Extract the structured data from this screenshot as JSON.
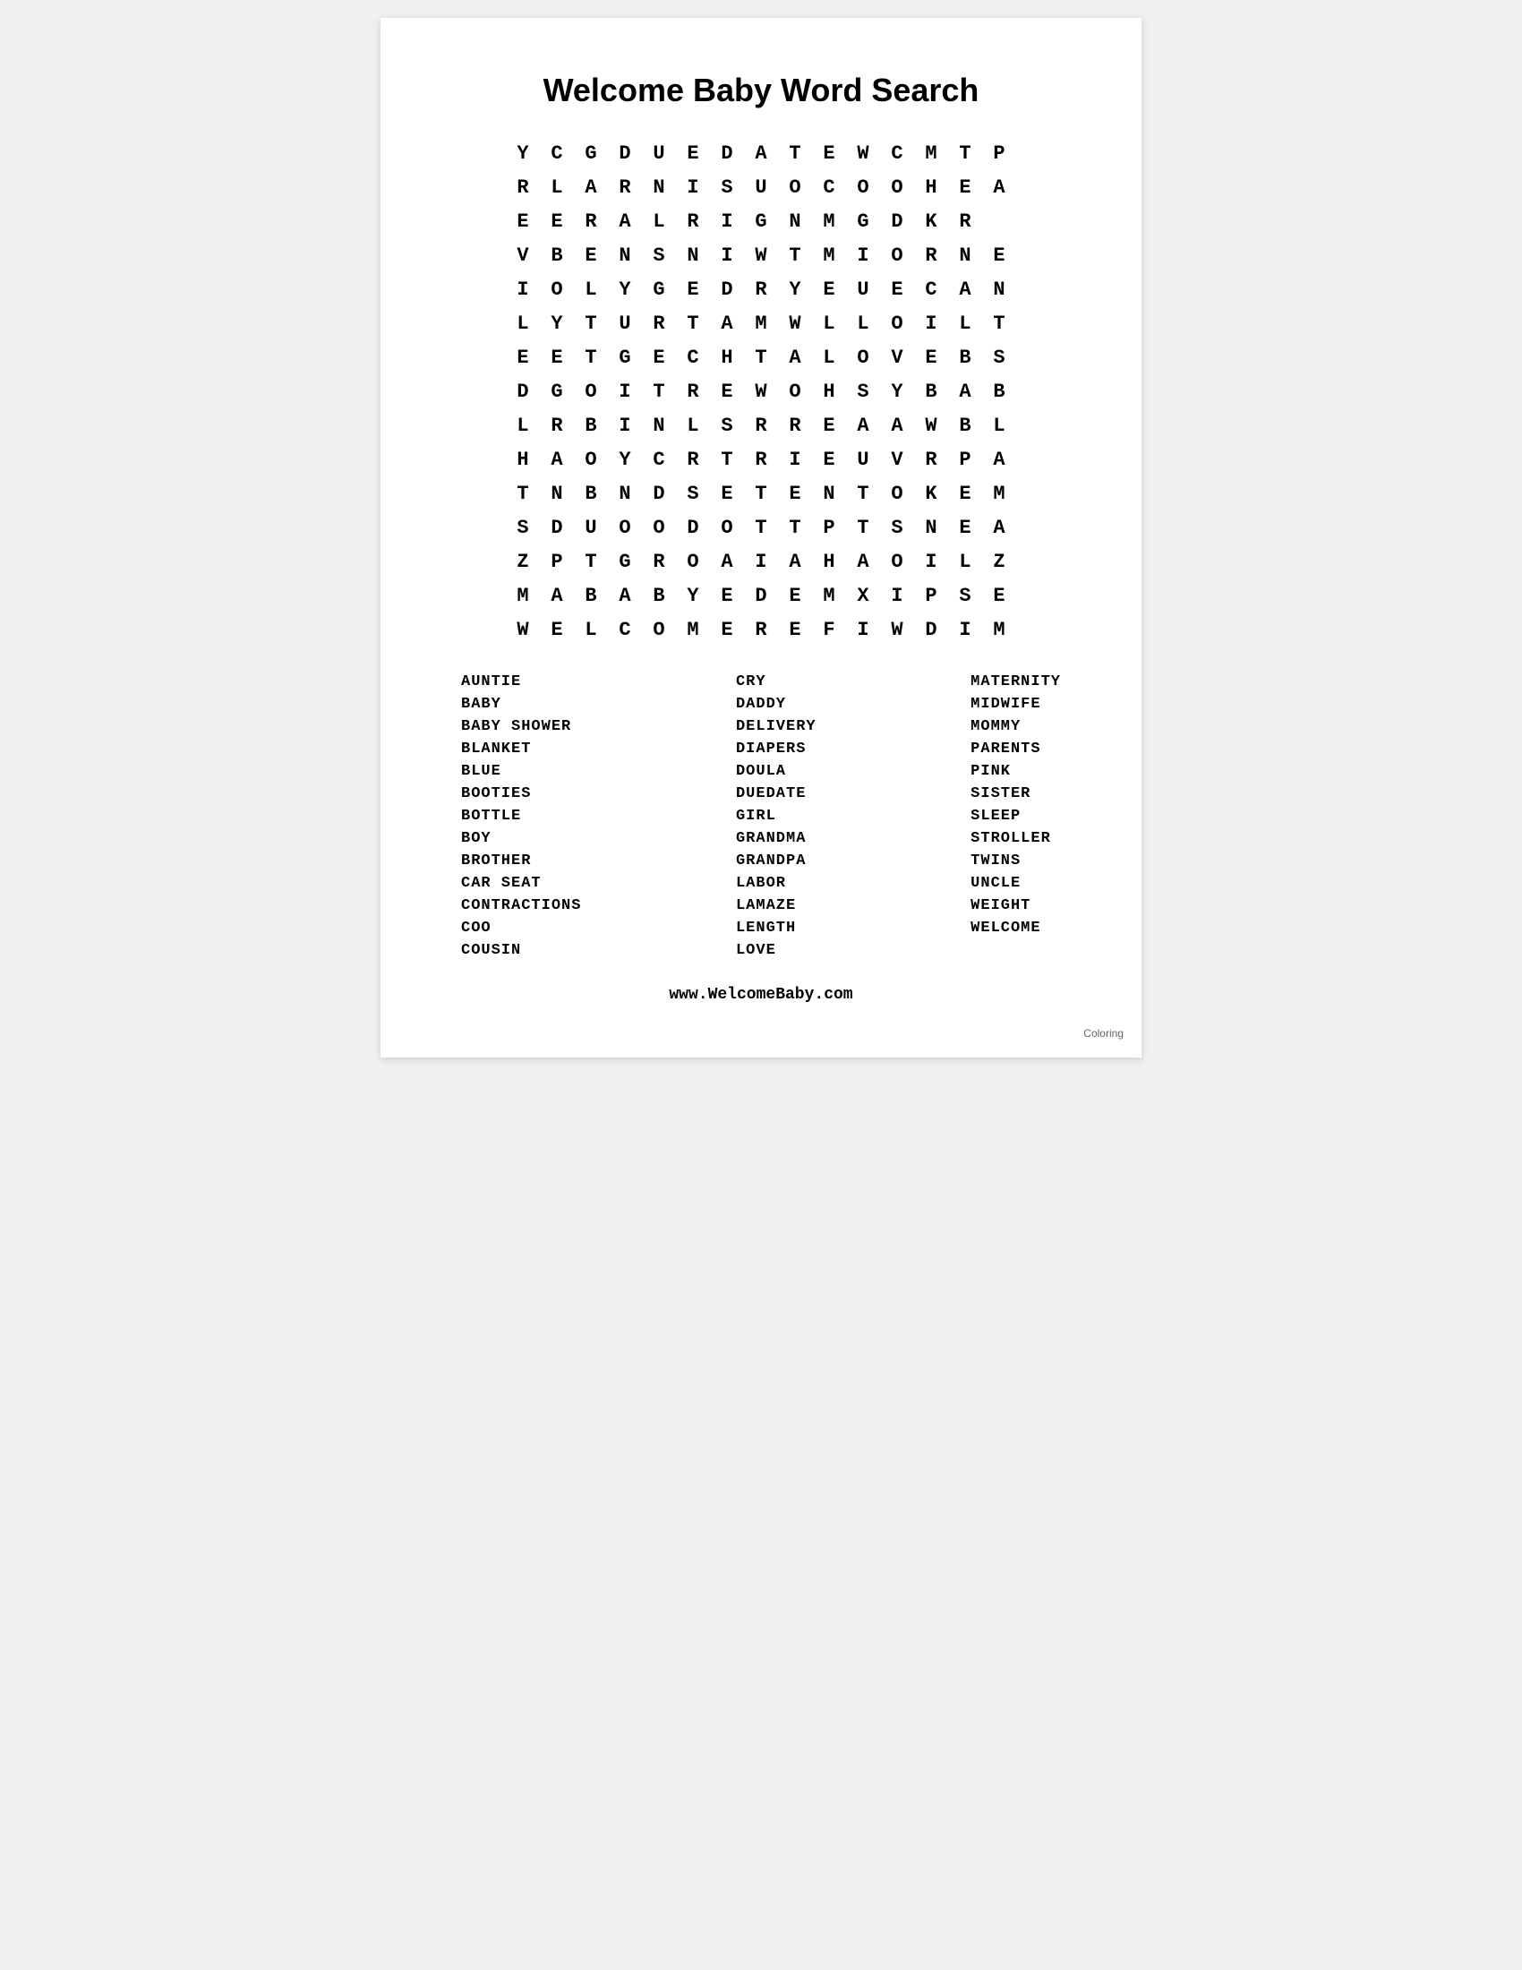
{
  "page": {
    "title": "Welcome Baby Word Search",
    "grid": [
      [
        "Y",
        "C",
        "G",
        "D",
        "U",
        "E",
        "D",
        "A",
        "T",
        "E",
        "W",
        "C",
        "M",
        "T",
        "P"
      ],
      [
        "R",
        "L",
        "A",
        "R",
        "N",
        "I",
        "S",
        "U",
        "O",
        "C",
        "O",
        "O",
        "H",
        "E",
        "A"
      ],
      [
        "E",
        "E",
        "R",
        "A",
        "L",
        "R",
        "I",
        "G",
        "N",
        "M",
        "G",
        "D",
        "K",
        "R",
        ""
      ],
      [
        "V",
        "B",
        "E",
        "N",
        "S",
        "N",
        "I",
        "W",
        "T",
        "M",
        "I",
        "O",
        "R",
        "N",
        "E"
      ],
      [
        "I",
        "O",
        "L",
        "Y",
        "G",
        "E",
        "D",
        "R",
        "Y",
        "E",
        "U",
        "E",
        "C",
        "A",
        "N"
      ],
      [
        "L",
        "Y",
        "T",
        "U",
        "R",
        "T",
        "A",
        "M",
        "W",
        "L",
        "L",
        "O",
        "I",
        "L",
        "T"
      ],
      [
        "E",
        "E",
        "T",
        "G",
        "E",
        "C",
        "H",
        "T",
        "A",
        "L",
        "O",
        "V",
        "E",
        "B",
        "S"
      ],
      [
        "D",
        "G",
        "O",
        "I",
        "T",
        "R",
        "E",
        "W",
        "O",
        "H",
        "S",
        "Y",
        "B",
        "A",
        "B"
      ],
      [
        "L",
        "R",
        "B",
        "I",
        "N",
        "L",
        "S",
        "R",
        "R",
        "E",
        "A",
        "A",
        "W",
        "B",
        "L"
      ],
      [
        "H",
        "A",
        "O",
        "Y",
        "C",
        "R",
        "T",
        "R",
        "I",
        "E",
        "U",
        "V",
        "R",
        "P",
        "A"
      ],
      [
        "T",
        "N",
        "B",
        "N",
        "D",
        "S",
        "E",
        "T",
        "E",
        "N",
        "T",
        "O",
        "K",
        "E",
        "M"
      ],
      [
        "S",
        "D",
        "U",
        "O",
        "O",
        "D",
        "O",
        "T",
        "T",
        "P",
        "T",
        "S",
        "N",
        "E",
        "A"
      ],
      [
        "Z",
        "P",
        "T",
        "G",
        "R",
        "O",
        "A",
        "I",
        "A",
        "H",
        "A",
        "O",
        "I",
        "L",
        "Z"
      ],
      [
        "M",
        "A",
        "B",
        "A",
        "B",
        "Y",
        "E",
        "D",
        "E",
        "M",
        "X",
        "I",
        "P",
        "S",
        "E"
      ],
      [
        "W",
        "E",
        "L",
        "C",
        "O",
        "M",
        "E",
        "R",
        "E",
        "F",
        "I",
        "W",
        "D",
        "I",
        "M"
      ]
    ],
    "word_list": {
      "column1": [
        "AUNTIE",
        "BABY",
        "BABY SHOWER",
        "BLANKET",
        "BLUE",
        "BOOTIES",
        "BOTTLE",
        "BOY",
        "BROTHER",
        "CAR SEAT",
        "CONTRACTIONS",
        "COO",
        "COUSIN"
      ],
      "column2": [
        "CRY",
        "DADDY",
        "DELIVERY",
        "DIAPERS",
        "DOULA",
        "DUEDATE",
        "GIRL",
        "GRANDMA",
        "GRANDPA",
        "LABOR",
        "LAMAZE",
        "LENGTH",
        "LOVE"
      ],
      "column3": [
        "MATERNITY",
        "MIDWIFE",
        "MOMMY",
        "PARENTS",
        "PINK",
        "SISTER",
        "SLEEP",
        "STROLLER",
        "TWINS",
        "UNCLE",
        "WEIGHT",
        "WELCOME"
      ]
    },
    "footer_url": "www.WelcomeBaby.com",
    "coloring_label": "Coloring"
  }
}
